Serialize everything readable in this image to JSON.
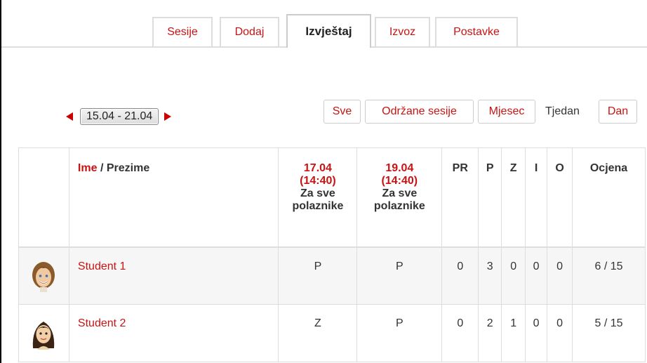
{
  "tabs": [
    {
      "label": "Sesije",
      "active": false
    },
    {
      "label": "Dodaj",
      "active": false
    },
    {
      "label": "Izvještaj",
      "active": true
    },
    {
      "label": "Izvoz",
      "active": false
    },
    {
      "label": "Postavke",
      "active": false
    }
  ],
  "week_nav": {
    "range": "15.04 - 21.04",
    "prev_icon": "triangle-left-icon",
    "next_icon": "triangle-right-icon"
  },
  "view_buttons": {
    "all": "Sve",
    "held": "Održane sesije",
    "month": "Mjesec",
    "week": "Tjedan",
    "day": "Dan"
  },
  "table": {
    "headers": {
      "first_name": "Ime",
      "separator": " / ",
      "last_name": "Prezime",
      "sessions": [
        {
          "date": "17.04",
          "time": "(14:40)",
          "desc_1": "Za sve",
          "desc_2": "polaznike"
        },
        {
          "date": "19.04",
          "time": "(14:40)",
          "desc_1": "Za sve",
          "desc_2": "polaznike"
        }
      ],
      "pr": "PR",
      "p": "P",
      "z": "Z",
      "i": "I",
      "o": "O",
      "grade": "Ocjena"
    },
    "rows": [
      {
        "name": "Student 1",
        "avatar": "boy-avatar-icon",
        "s1": "P",
        "s2": "P",
        "pr": "0",
        "p": "3",
        "z": "0",
        "i": "0",
        "o": "0",
        "grade": "6 / 15"
      },
      {
        "name": "Student 2",
        "avatar": "girl-avatar-icon",
        "s1": "Z",
        "s2": "P",
        "pr": "0",
        "p": "2",
        "z": "1",
        "i": "0",
        "o": "0",
        "grade": "5 / 15"
      }
    ]
  },
  "colors": {
    "link": "#c91313",
    "arrow": "#cc0000",
    "border": "#dddddd"
  }
}
